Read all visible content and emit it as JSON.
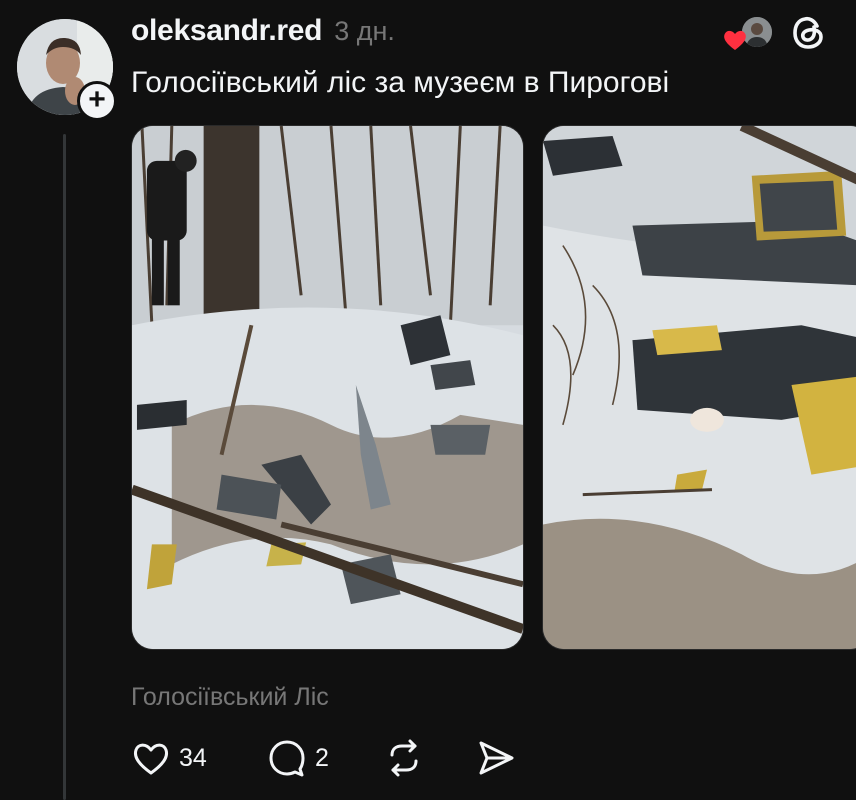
{
  "post": {
    "username": "oleksandr.red",
    "time": "3 дн.",
    "caption": "Голосіївський ліс за музеєм в Пирогові",
    "location": "Голосіївський Ліс",
    "likes": "34",
    "replies": "2"
  },
  "icons": {
    "follow": "plus-icon",
    "liked_by": "heart-icon",
    "app": "threads-logo",
    "like": "heart-outline-icon",
    "reply": "speech-bubble-icon",
    "repost": "repost-arrows-icon",
    "share": "send-arrow-icon"
  },
  "colors": {
    "background": "#101010",
    "text": "#f3f5f7",
    "secondary_text": "#777777",
    "heart_red": "#ff3040"
  }
}
